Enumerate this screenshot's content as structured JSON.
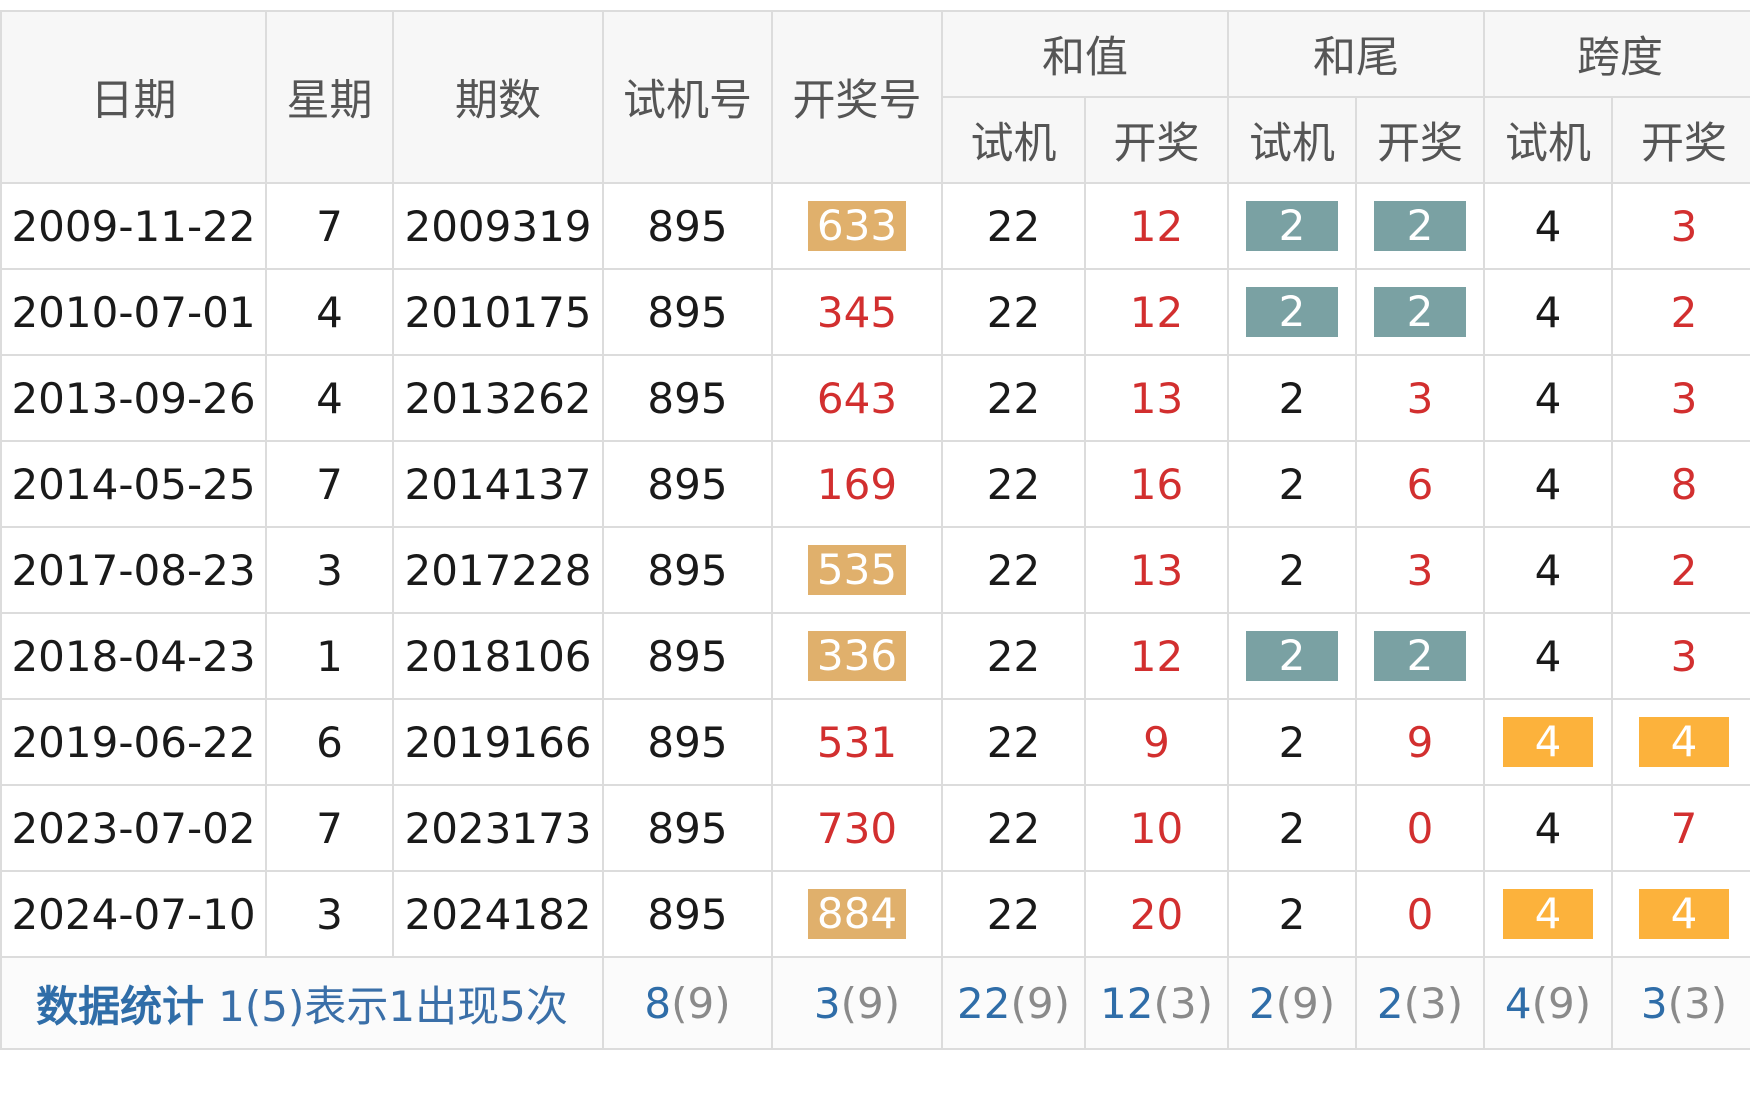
{
  "headers": {
    "date": "日期",
    "weekday": "星期",
    "period": "期数",
    "trial": "试机号",
    "draw": "开奖号",
    "sum": "和值",
    "tail": "和尾",
    "span": "跨度",
    "sub_trial": "试机",
    "sub_draw": "开奖"
  },
  "rows": [
    {
      "date": "2009-11-22",
      "weekday": "7",
      "period": "2009319",
      "trial": "895",
      "draw": "633",
      "sum_trial": "22",
      "sum_draw": "12",
      "tail_trial": "2",
      "tail_draw": "2",
      "span_trial": "4",
      "span_draw": "3"
    },
    {
      "date": "2010-07-01",
      "weekday": "4",
      "period": "2010175",
      "trial": "895",
      "draw": "345",
      "sum_trial": "22",
      "sum_draw": "12",
      "tail_trial": "2",
      "tail_draw": "2",
      "span_trial": "4",
      "span_draw": "2"
    },
    {
      "date": "2013-09-26",
      "weekday": "4",
      "period": "2013262",
      "trial": "895",
      "draw": "643",
      "sum_trial": "22",
      "sum_draw": "13",
      "tail_trial": "2",
      "tail_draw": "3",
      "span_trial": "4",
      "span_draw": "3"
    },
    {
      "date": "2014-05-25",
      "weekday": "7",
      "period": "2014137",
      "trial": "895",
      "draw": "169",
      "sum_trial": "22",
      "sum_draw": "16",
      "tail_trial": "2",
      "tail_draw": "6",
      "span_trial": "4",
      "span_draw": "8"
    },
    {
      "date": "2017-08-23",
      "weekday": "3",
      "period": "2017228",
      "trial": "895",
      "draw": "535",
      "sum_trial": "22",
      "sum_draw": "13",
      "tail_trial": "2",
      "tail_draw": "3",
      "span_trial": "4",
      "span_draw": "2"
    },
    {
      "date": "2018-04-23",
      "weekday": "1",
      "period": "2018106",
      "trial": "895",
      "draw": "336",
      "sum_trial": "22",
      "sum_draw": "12",
      "tail_trial": "2",
      "tail_draw": "2",
      "span_trial": "4",
      "span_draw": "3"
    },
    {
      "date": "2019-06-22",
      "weekday": "6",
      "period": "2019166",
      "trial": "895",
      "draw": "531",
      "sum_trial": "22",
      "sum_draw": "9",
      "tail_trial": "2",
      "tail_draw": "9",
      "span_trial": "4",
      "span_draw": "4"
    },
    {
      "date": "2023-07-02",
      "weekday": "7",
      "period": "2023173",
      "trial": "895",
      "draw": "730",
      "sum_trial": "22",
      "sum_draw": "10",
      "tail_trial": "2",
      "tail_draw": "0",
      "span_trial": "4",
      "span_draw": "7"
    },
    {
      "date": "2024-07-10",
      "weekday": "3",
      "period": "2024182",
      "trial": "895",
      "draw": "884",
      "sum_trial": "22",
      "sum_draw": "20",
      "tail_trial": "2",
      "tail_draw": "0",
      "span_trial": "4",
      "span_draw": "4"
    }
  ],
  "stats": {
    "title": "数据统计",
    "desc": "1(5)表示1出现5次",
    "trial": {
      "val": "8",
      "cnt": "(9)"
    },
    "draw": {
      "val": "3",
      "cnt": "(9)"
    },
    "sum_trial": {
      "val": "22",
      "cnt": "(9)"
    },
    "sum_draw": {
      "val": "12",
      "cnt": "(3)"
    },
    "tail_trial": {
      "val": "2",
      "cnt": "(9)"
    },
    "tail_draw": {
      "val": "2",
      "cnt": "(3)"
    },
    "span_trial": {
      "val": "4",
      "cnt": "(9)"
    },
    "span_draw": {
      "val": "3",
      "cnt": "(3)"
    }
  }
}
